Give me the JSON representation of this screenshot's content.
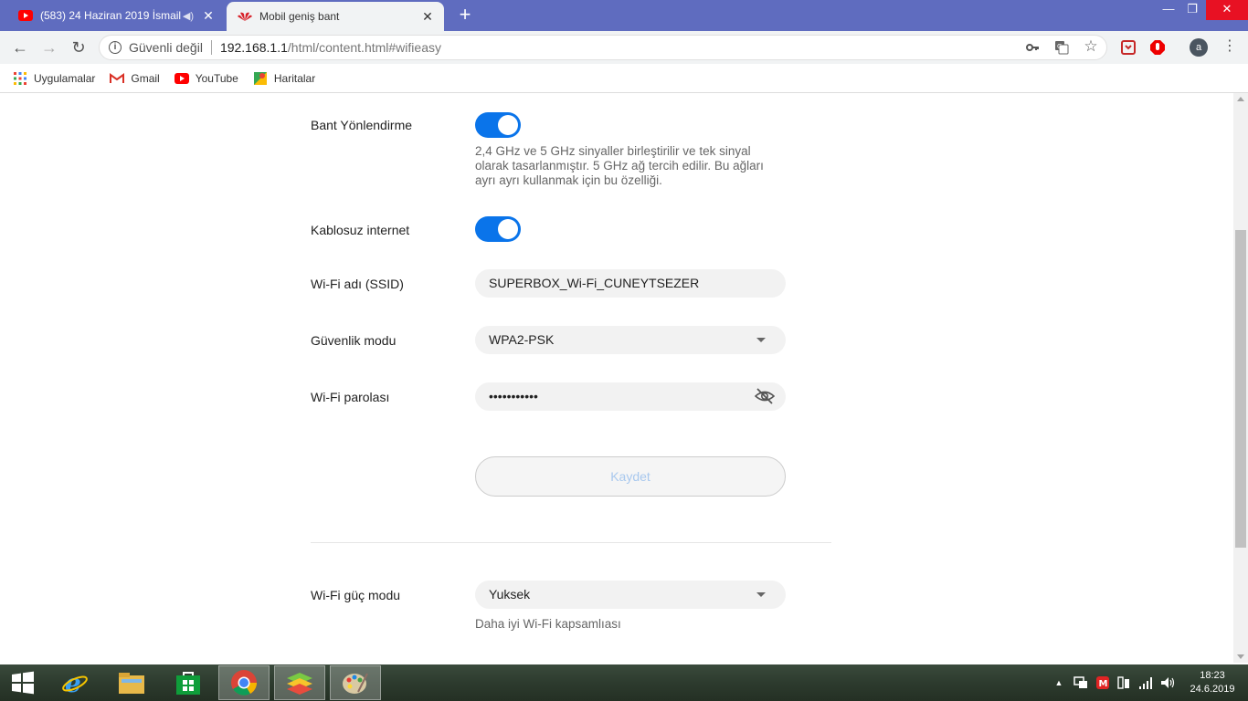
{
  "browser": {
    "tabs": [
      {
        "title": "(583) 24 Haziran 2019 İsmail",
        "favicon": "youtube-icon",
        "audio": true,
        "active": false
      },
      {
        "title": "Mobil geniş bant",
        "favicon": "huawei-icon",
        "active": true
      }
    ],
    "address": {
      "security_label": "Güvenli değil",
      "host": "192.168.1.1",
      "path": "/html/content.html#wifieasy"
    },
    "profile_initial": "a",
    "bookmarks": [
      {
        "label": "Uygulamalar",
        "icon": "apps-grid-icon"
      },
      {
        "label": "Gmail",
        "icon": "gmail-icon"
      },
      {
        "label": "YouTube",
        "icon": "youtube-icon"
      },
      {
        "label": "Haritalar",
        "icon": "maps-icon"
      }
    ]
  },
  "settings": {
    "band_steering": {
      "label": "Bant Yönlendirme",
      "enabled": true,
      "description": "2,4 GHz ve 5 GHz sinyaller birleştirilir ve tek sinyal olarak tasarlanmıştır. 5 GHz ağ tercih edilir. Bu ağları ayrı ayrı kullanmak için bu özelliği."
    },
    "wireless": {
      "label": "Kablosuz internet",
      "enabled": true
    },
    "ssid": {
      "label": "Wi-Fi adı (SSID)",
      "value": "SUPERBOX_Wi-Fi_CUNEYTSEZER"
    },
    "security_mode": {
      "label": "Güvenlik modu",
      "value": "WPA2-PSK"
    },
    "password": {
      "label": "Wi-Fi parolası",
      "value": "•••••••••••"
    },
    "save_label": "Kaydet",
    "power_mode": {
      "label": "Wi-Fi güç modu",
      "value": "Yuksek",
      "hint": "Daha iyi Wi-Fi kapsamlıası"
    }
  },
  "taskbar": {
    "clock_time": "18:23",
    "clock_date": "24.6.2019",
    "pinned": [
      "ie-icon",
      "file-explorer-icon",
      "store-icon",
      "chrome-icon",
      "bluestacks-icon",
      "paint-icon"
    ]
  },
  "colors": {
    "tabstrip": "#5f6cbf",
    "accent_blue": "#0a74ea",
    "field_bg": "#f2f2f2"
  }
}
